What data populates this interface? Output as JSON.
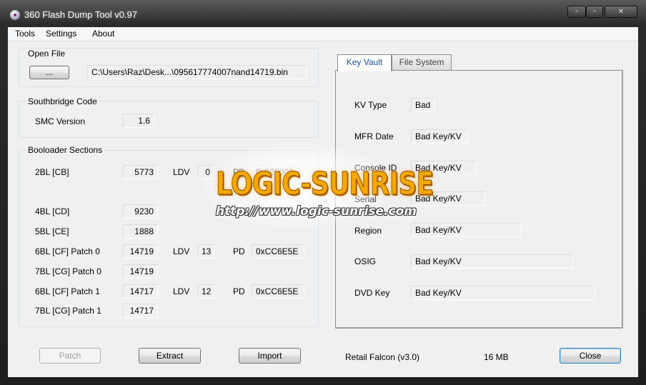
{
  "window": {
    "title": "360 Flash Dump Tool  v0.97",
    "minimize_glyph": "▫",
    "maximize_glyph": "▫",
    "close_glyph": "✕"
  },
  "menu": {
    "items": [
      "Tools",
      "Settings",
      "About"
    ]
  },
  "open_file": {
    "label": "Open File",
    "browse_label": "...",
    "path": "C:\\Users\\Raz\\Desk...\\095617774007nand14719.bin"
  },
  "southbridge": {
    "label": "Southbridge Code",
    "smc_version_label": "SMC Version",
    "smc_version": "1.6"
  },
  "bootloader": {
    "label": "Booloader Sections",
    "ldv_label": "LDV",
    "pd_label": "PD",
    "rows": [
      {
        "name": "2BL [CB]",
        "value": "5773",
        "ldv": "0",
        "pd": "0x020000"
      },
      {
        "name": "4BL [CD]",
        "value": "9230"
      },
      {
        "name": "5BL [CE]",
        "value": "1888"
      },
      {
        "name": "6BL [CF] Patch 0",
        "value": "14719",
        "ldv": "13",
        "pd": "0xCC6E5E"
      },
      {
        "name": "7BL [CG] Patch 0",
        "value": "14719"
      },
      {
        "name": "6BL [CF] Patch 1",
        "value": "14717",
        "ldv": "12",
        "pd": "0xCC6E5E"
      },
      {
        "name": "7BL [CG] Patch 1",
        "value": "14717"
      }
    ]
  },
  "tabs": [
    "Key Vault",
    "File System"
  ],
  "keyvault": {
    "rows": [
      {
        "label": "KV Type",
        "value": "Bad"
      },
      {
        "label": "MFR Date",
        "value": "Bad Key/KV"
      },
      {
        "label": "Console ID",
        "value": "Bad Key/KV"
      },
      {
        "label": "Serial",
        "value": "Bad Key/KV"
      },
      {
        "label": "Region",
        "value": "Bad Key/KV"
      },
      {
        "label": "OSIG",
        "value": "Bad Key/KV"
      },
      {
        "label": "DVD Key",
        "value": "Bad Key/KV"
      }
    ]
  },
  "buttons": {
    "patch": "Patch",
    "extract": "Extract",
    "import": "Import",
    "close": "Close"
  },
  "status": {
    "console_type": "Retail Falcon (v3.0)",
    "size": "16 MB"
  },
  "watermark": {
    "logo": "LOGIC-SUNRISE",
    "url": "http://www.logic-sunrise.com"
  }
}
